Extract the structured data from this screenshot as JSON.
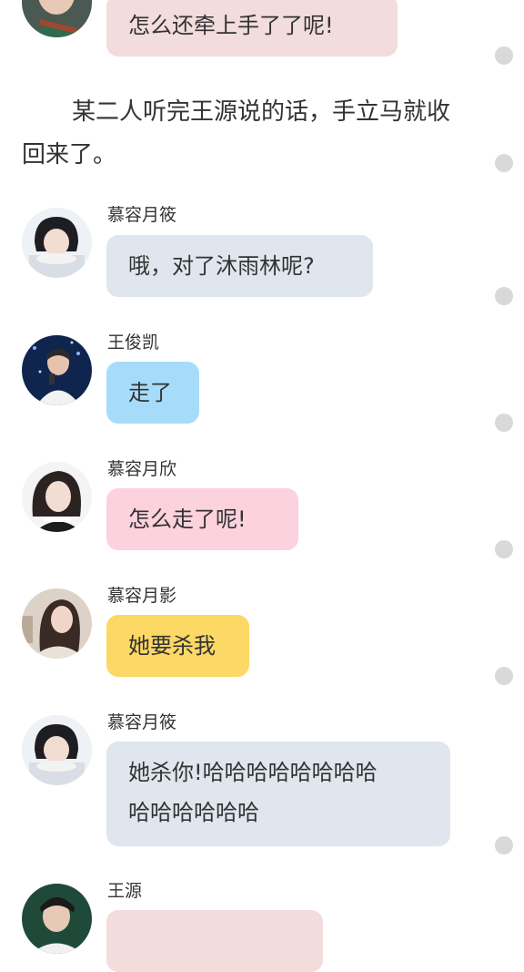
{
  "messages": [
    {
      "id": "m0",
      "speaker": "",
      "text": "怎么还牵上手了了呢!",
      "bubble_color": "#f3dcdc",
      "avatar": "avatar-wang-yuan"
    },
    {
      "id": "m1",
      "speaker": "慕容月筱",
      "text": "哦，对了沐雨林呢?",
      "bubble_color": "#dfe6ee",
      "avatar": "avatar-murong-yuexiao"
    },
    {
      "id": "m2",
      "speaker": "王俊凯",
      "text": "走了",
      "bubble_color": "#a6dcfa",
      "avatar": "avatar-wang-junkai"
    },
    {
      "id": "m3",
      "speaker": "慕容月欣",
      "text": "怎么走了呢!",
      "bubble_color": "#fbd2dd",
      "avatar": "avatar-murong-yuexin"
    },
    {
      "id": "m4",
      "speaker": "慕容月影",
      "text": "她要杀我",
      "bubble_color": "#fcd864",
      "avatar": "avatar-murong-yueying"
    },
    {
      "id": "m5",
      "speaker": "慕容月筱",
      "text_line1": "她杀你!哈哈哈哈哈哈哈哈",
      "text_line2": "哈哈哈哈哈哈",
      "bubble_color": "#dfe6ee",
      "avatar": "avatar-murong-yuexiao"
    },
    {
      "id": "m6",
      "speaker": "王源",
      "text": "",
      "bubble_color": "#f3dcdc",
      "avatar": "avatar-wang-yuan"
    }
  ],
  "narration": {
    "line1": "某二人听完王源说的话，手立马就收",
    "line2": "回来了。"
  },
  "colors": {
    "text": "#333333",
    "dot": "#d9d9d9",
    "background": "#ffffff"
  }
}
